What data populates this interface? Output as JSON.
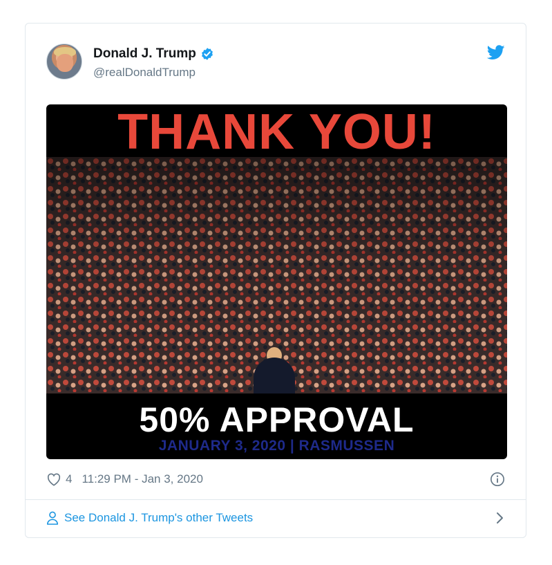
{
  "tweet": {
    "author_name": "Donald J. Trump",
    "author_handle": "@realDonaldTrump",
    "verified": true,
    "likes": "4",
    "timestamp": "11:29 PM - Jan 3, 2020"
  },
  "image": {
    "headline": "THANK YOU!",
    "subheadline": "50% APPROVAL",
    "caption": "JANUARY 3, 2020 | RASMUSSEN"
  },
  "footer": {
    "link_text": "See Donald J. Trump's other Tweets"
  },
  "colors": {
    "twitter_blue": "#1da1f2",
    "link_blue": "#1b95e0",
    "headline_red": "#e8483a"
  },
  "icons": {
    "verified": "verified-badge-icon",
    "twitter": "twitter-bird-icon",
    "like": "heart-icon",
    "info": "info-icon",
    "person": "person-icon",
    "chevron": "chevron-right-icon"
  }
}
